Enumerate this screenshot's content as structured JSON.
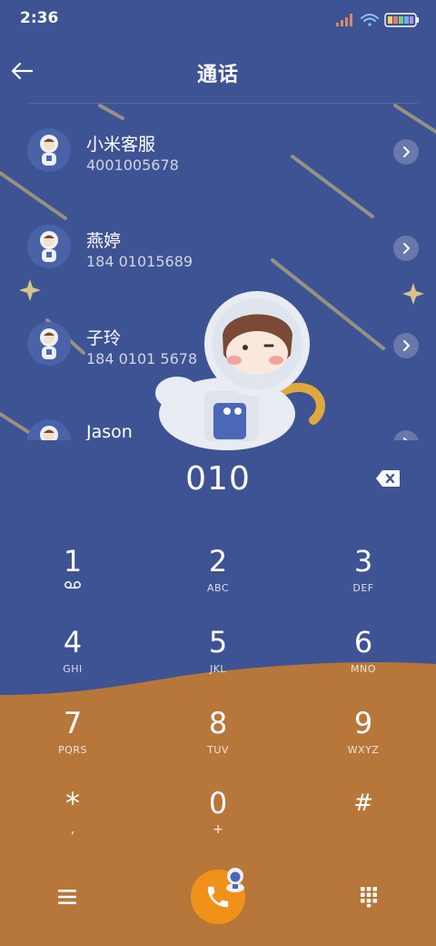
{
  "status_bar": {
    "time": "2:36"
  },
  "header": {
    "title": "通话"
  },
  "contacts": [
    {
      "name": "小米客服",
      "number": "4001005678"
    },
    {
      "name": "燕婷",
      "number": "184 01015689"
    },
    {
      "name": "子玲",
      "number": "184 0101 5678"
    },
    {
      "name": "Jason",
      "number": ""
    }
  ],
  "dialer": {
    "number": "010"
  },
  "keypad": [
    {
      "digit": "1",
      "letters": ""
    },
    {
      "digit": "2",
      "letters": "ABC"
    },
    {
      "digit": "3",
      "letters": "DEF"
    },
    {
      "digit": "4",
      "letters": "GHI"
    },
    {
      "digit": "5",
      "letters": "JKL"
    },
    {
      "digit": "6",
      "letters": "MNO"
    },
    {
      "digit": "7",
      "letters": "PQRS"
    },
    {
      "digit": "8",
      "letters": "TUV"
    },
    {
      "digit": "9",
      "letters": "WXYZ"
    },
    {
      "digit": "*",
      "letters": ","
    },
    {
      "digit": "0",
      "letters": "+"
    },
    {
      "digit": "#",
      "letters": ""
    }
  ],
  "colors": {
    "background_blue": "#3e5393",
    "ground_orange": "#b7773b",
    "call_button": "#f0921a"
  },
  "icons": {
    "back": "arrow-left-icon",
    "detail": "chevron-right-icon",
    "delete": "backspace-icon",
    "menu": "menu-icon",
    "call": "phone-icon",
    "keypad_toggle": "dialpad-icon",
    "voicemail": "voicemail-icon"
  }
}
